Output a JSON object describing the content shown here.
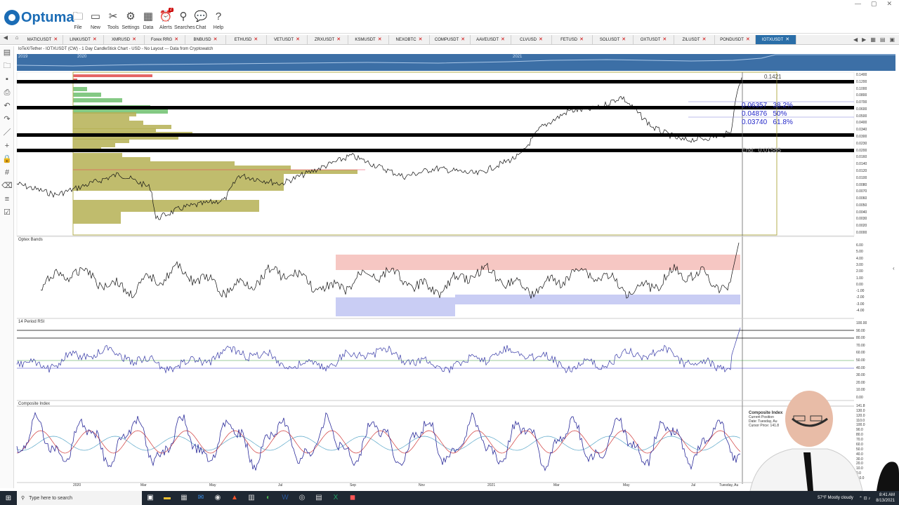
{
  "ribbon": {
    "logo": "Optuma",
    "buttons": [
      {
        "label": "File",
        "icon": "folder-icon",
        "glyph": "🗀"
      },
      {
        "label": "New",
        "icon": "new-page-icon",
        "glyph": "▭"
      },
      {
        "label": "Tools",
        "icon": "tools-icon",
        "glyph": "✂"
      },
      {
        "label": "Settings",
        "icon": "gear-icon",
        "glyph": "⚙"
      },
      {
        "label": "Data",
        "icon": "data-icon",
        "glyph": "▦"
      },
      {
        "label": "Alerts",
        "icon": "alarm-icon",
        "glyph": "⏰"
      },
      {
        "label": "Searches",
        "icon": "search-icon",
        "glyph": "⚲"
      },
      {
        "label": "Chat",
        "icon": "chat-icon",
        "glyph": "💬"
      },
      {
        "label": "Help",
        "icon": "help-icon",
        "glyph": "?"
      }
    ],
    "alerts_badge": "2"
  },
  "tabs": [
    "MATICUSDT",
    "LINKUSDT",
    "XMRUSD",
    "Forex RRG",
    "BNBUSD",
    "ETHUSD",
    "VETUSDT",
    "ZRXUSDT",
    "KSMUSDT",
    "NEXOBTC",
    "COMPUSDT",
    "AAVEUSDT",
    "CLVUSD",
    "FETUSD",
    "SOLUSDT",
    "OXTUSDT",
    "ZILUSDT",
    "PONDUSDT",
    "IOTXUSDT"
  ],
  "chart": {
    "title": "IoTeX/Tether - IOTXUSDT (CW) - 1 Day CandleStick Chart - USD - No Layout --- Data from Cryptowatch",
    "timeline_labels": [
      "2019",
      "2020",
      "2021"
    ],
    "price_axis": [
      "0.1400",
      "0.1200",
      "0.1000",
      "0.0800",
      "0.0700",
      "0.0600",
      "0.0500",
      "0.0400",
      "0.0340",
      "0.0300",
      "0.0230",
      "0.0200",
      "0.0160",
      "0.0140",
      "0.0120",
      "0.0100",
      "0.0080",
      "0.0070",
      "0.0060",
      "0.0050",
      "0.0040",
      "0.0030",
      "0.0020",
      "0.0000"
    ],
    "fib_levels": [
      {
        "price": "0.06357",
        "pct": "38.2%"
      },
      {
        "price": "0.04876",
        "pct": "50%"
      },
      {
        "price": "0.03740",
        "pct": "61.8%"
      }
    ],
    "fib_top": "0.1421",
    "fib_end_label": "End:",
    "fib_end_value": "0.01585",
    "x_axis": [
      "2020",
      "Mar",
      "May",
      "Jul",
      "Sep",
      "Nov",
      "2021",
      "Mar",
      "May",
      "Jul",
      "Tuesday, Au"
    ]
  },
  "optex": {
    "title": "Optex Bands",
    "axis": [
      "6.00",
      "5.00",
      "4.00",
      "3.00",
      "2.00",
      "1.00",
      "0.00",
      "-1.00",
      "-2.00",
      "-3.00",
      "-4.00"
    ]
  },
  "rsi": {
    "title": "14 Period RSI",
    "axis": [
      "100.00",
      "90.00",
      "80.00",
      "70.00",
      "60.00",
      "50.00",
      "40.00",
      "30.00",
      "20.00",
      "10.00",
      "0.00"
    ]
  },
  "composite": {
    "title": "Composite Index",
    "axis": [
      "141.8",
      "130.0",
      "120.0",
      "110.0",
      "100.0",
      "90.0",
      "80.0",
      "70.0",
      "60.0",
      "50.0",
      "40.0",
      "30.0",
      "20.0",
      "10.0",
      "0.0",
      "-10.0"
    ],
    "tooltip_title": "Composite Index",
    "tooltip_lines": [
      "Current Position",
      "Date: Tuesday, Au",
      "Cursor Price: 141.8"
    ]
  },
  "taskbar": {
    "search_placeholder": "Type here to search",
    "weather": "57°F Mostly cloudy",
    "time": "8:41 AM",
    "date": "8/13/2021"
  },
  "colors": {
    "accent": "#2a6ea8",
    "volume_profile": "#b5b053",
    "fib_text": "#2327c9",
    "optex_upper": "#f6c7c3",
    "optex_lower": "#c9cdf4"
  }
}
